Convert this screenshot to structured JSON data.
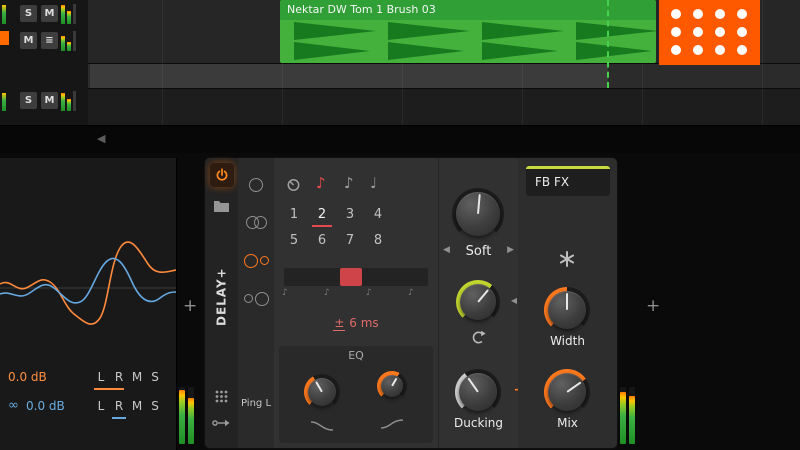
{
  "arranger": {
    "clip_title": "Nektar DW Tom 1 Brush 03",
    "tracks": [
      {
        "btn1": "S",
        "btn2": "M"
      },
      {
        "btn1": "M",
        "btn2": "≡"
      },
      {
        "btn1": "S",
        "btn2": "M"
      }
    ],
    "scroll_arrow": "◀"
  },
  "device": {
    "name": "DELAY+",
    "tab_label": "Ping L",
    "sync": {
      "notes": [
        "♪",
        "♪",
        "♩"
      ],
      "numbers": [
        "1",
        "2",
        "3",
        "4",
        "5",
        "6",
        "7",
        "8"
      ],
      "selected_number": "2",
      "tick": "♪",
      "offset_sign": "±",
      "offset_value": "6 ms"
    },
    "eq_label": "EQ",
    "soft": {
      "label": "Soft",
      "left": "◀",
      "right": "▶"
    },
    "feedback": {
      "left": "◀"
    },
    "ducking_label": "Ducking",
    "route_arrow": "→",
    "fb_fx_label": "FB FX",
    "width_label": "Width",
    "mix_label": "Mix"
  },
  "panel": {
    "add_left": "+",
    "add_right": "+"
  },
  "inspector": {
    "row1": {
      "gain": "0.0 dB",
      "channels": [
        "L",
        "R",
        "M",
        "S"
      ]
    },
    "row2": {
      "link": "∞",
      "gain": "0.0 dB",
      "channels": [
        "L",
        "R",
        "M",
        "S"
      ]
    }
  },
  "colors": {
    "orange": "#ff6a00",
    "red": "#e5484d",
    "green": "#3fae3f",
    "chartreuse": "#c9da3e",
    "blue": "#66a8e0"
  }
}
